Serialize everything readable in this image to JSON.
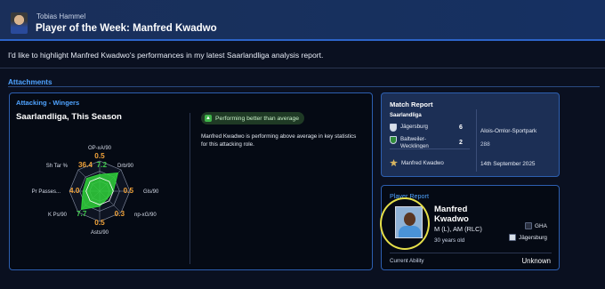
{
  "header": {
    "sender": "Tobias Hammel",
    "subject": "Player of the Week: Manfred Kwadwo",
    "avatar_icon": "person-avatar"
  },
  "message": {
    "body": "I'd like to highlight Manfred Kwadwo's performances in my latest Saarlandliga analysis report."
  },
  "attachments_label": "Attachments",
  "analysis_panel": {
    "title": "Attacking - Wingers",
    "subtitle": "Saarlandliga, This Season",
    "badge": "Performing better than average",
    "badge_icon": "thumbs-up-icon",
    "description": "Manfred Kwadwo is performing above average in key statistics for this attacking role."
  },
  "chart_data": {
    "type": "radar",
    "axes": [
      {
        "label": "OP-xA/90",
        "value": "0.5",
        "color": "#f0a23a"
      },
      {
        "label": "Drb/90",
        "value": "7.2",
        "color": "#3ec94a"
      },
      {
        "label": "Gls/90",
        "value": "0.5",
        "color": "#f0a23a"
      },
      {
        "label": "np-xG/90",
        "value": "0.3",
        "color": "#f0a23a"
      },
      {
        "label": "Asts/90",
        "value": "0.5",
        "color": "#f0a23a"
      },
      {
        "label": "K Ps/90",
        "value": "7.7",
        "color": "#3ec94a"
      },
      {
        "label": "Pr Passes...",
        "value": "4.0",
        "color": "#f0a23a"
      },
      {
        "label": "Sh Tar %",
        "value": "36.4",
        "color": "#f0a23a"
      }
    ],
    "levels": [
      0.55,
      0.85,
      0.45,
      0.35,
      0.5,
      0.85,
      0.55,
      0.6
    ],
    "average_levels": [
      0.45,
      0.45,
      0.45,
      0.45,
      0.45,
      0.45,
      0.45,
      0.45
    ],
    "colors": {
      "player": "#2fd13a",
      "average": "#ffffff"
    }
  },
  "match_report": {
    "title": "Match Report",
    "competition": "Saarlandliga",
    "home_team": "Jägersburg",
    "home_score": "6",
    "away_team": "Baltweiler-Wecklingen",
    "away_score": "2",
    "venue": "Alois-Omlor-Sportpark",
    "attendance": "288",
    "player_of_match": "Manfred Kwadwo",
    "date": "14th September 2025"
  },
  "player_report": {
    "title": "Player Report",
    "first_name": "Manfred",
    "last_name": "Kwadwo",
    "positions": "M (L), AM (RLC)",
    "age": "30 years old",
    "nationality": "GHA",
    "club": "Jägersburg",
    "current_ability_label": "Current Ability",
    "current_ability_value": "Unknown"
  },
  "colors": {
    "accent": "#4fa3ff",
    "panel_border": "#2d5fb0",
    "highlight": "#e6e04a"
  }
}
